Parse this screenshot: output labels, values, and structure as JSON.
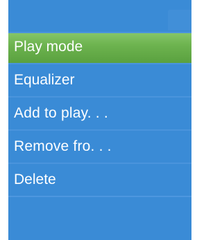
{
  "colors": {
    "background": "#3a8bd6",
    "selected": "#6db34f",
    "text": "#ffffff",
    "separator": "#4d97df"
  },
  "menu": {
    "items": [
      {
        "label": "Play mode",
        "selected": true
      },
      {
        "label": "Equalizer",
        "selected": false
      },
      {
        "label": "Add to play. . .",
        "selected": false
      },
      {
        "label": "Remove fro. . .",
        "selected": false
      },
      {
        "label": "Delete",
        "selected": false
      }
    ]
  }
}
